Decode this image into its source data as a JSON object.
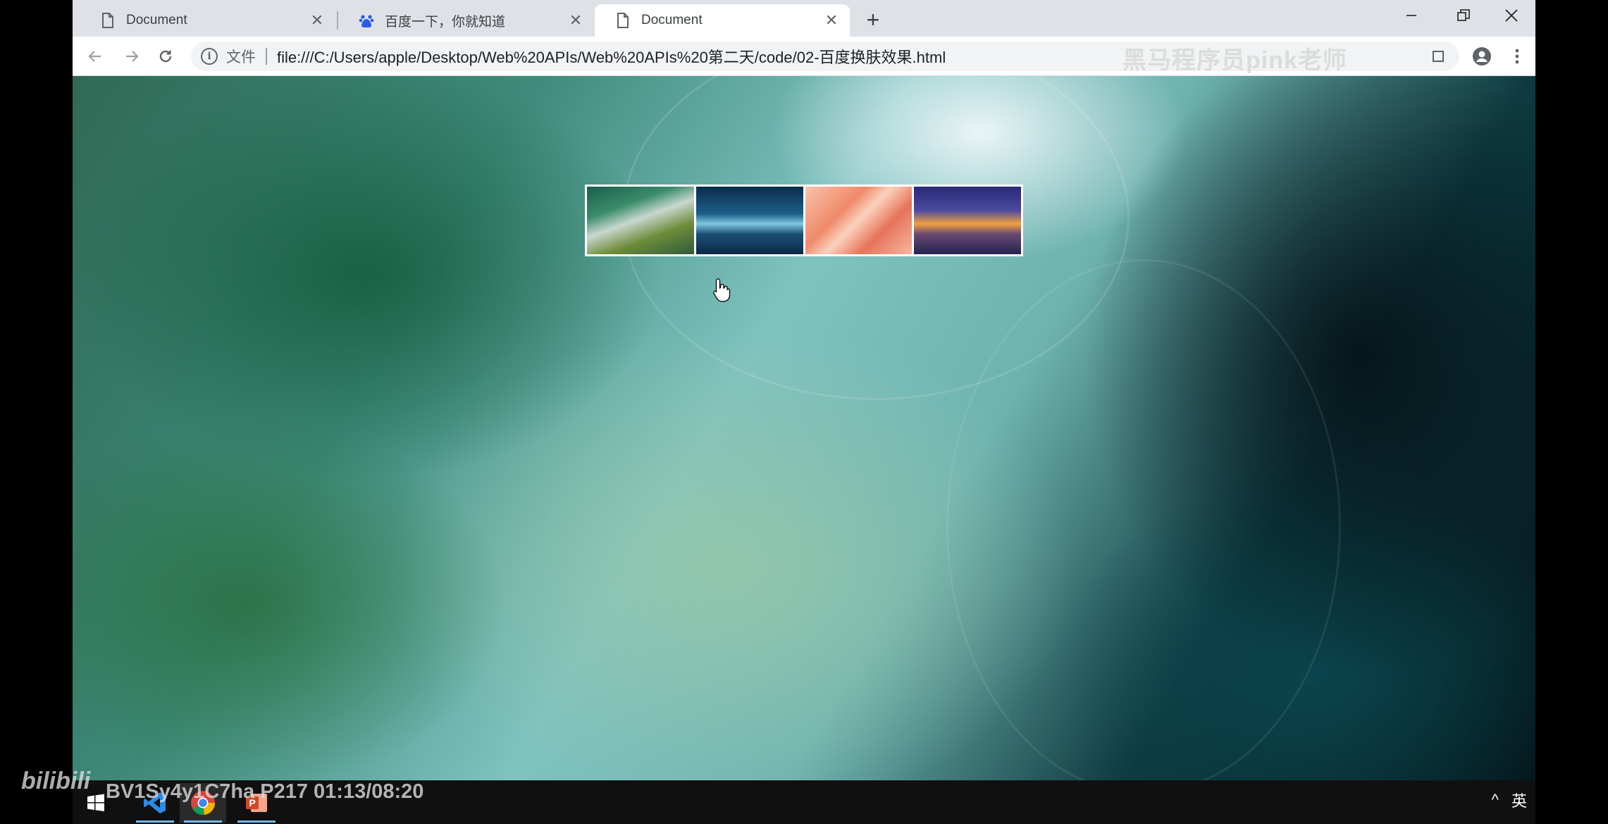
{
  "tabs": [
    {
      "title": "Document",
      "icon": "file-icon",
      "active": false
    },
    {
      "title": "百度一下，你就知道",
      "icon": "baidu-paw-icon",
      "active": false
    },
    {
      "title": "Document",
      "icon": "file-icon",
      "active": true
    }
  ],
  "toolbar": {
    "scheme_chip": "文件",
    "url": "file:///C:/Users/apple/Desktop/Web%20APIs/Web%20APIs%20第二天/code/02-百度换肤效果.html",
    "watermark": "黑马程序员pink老师"
  },
  "page": {
    "skins": [
      {
        "name": "skin-1"
      },
      {
        "name": "skin-2"
      },
      {
        "name": "skin-3"
      },
      {
        "name": "skin-4"
      }
    ]
  },
  "taskbar": {
    "tray_lang": "英",
    "tray_chevron": "^"
  },
  "overlay": {
    "brand": "bilibili",
    "video_info": "BV1Sy4y1C7ha P217 01:13/08:20"
  }
}
